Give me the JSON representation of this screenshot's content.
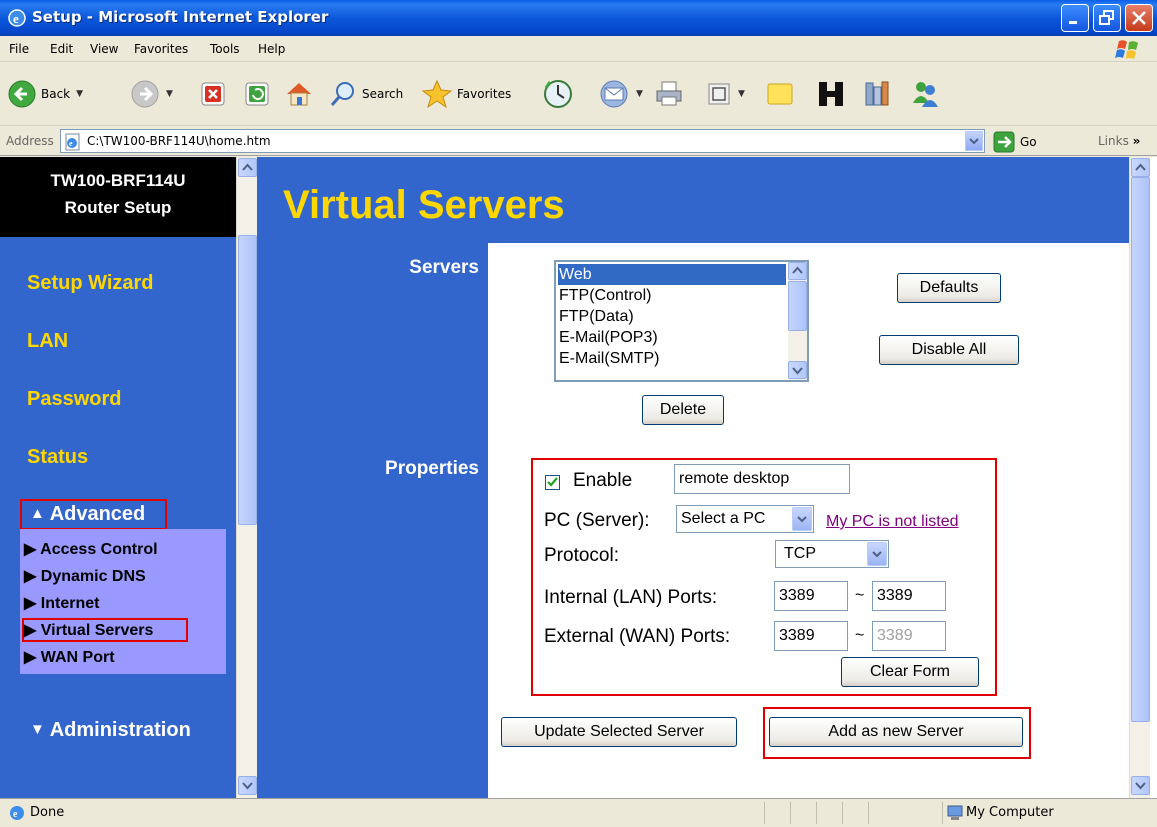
{
  "window": {
    "title": "Setup - Microsoft Internet Explorer"
  },
  "menubar": [
    "File",
    "Edit",
    "View",
    "Favorites",
    "Tools",
    "Help"
  ],
  "toolbar": {
    "back_label": "Back",
    "search_label": "Search",
    "favorites_label": "Favorites"
  },
  "address": {
    "label": "Address",
    "url": "C:\\TW100-BRF114U\\home.htm",
    "go_label": "Go",
    "links_label": "Links"
  },
  "sidebar": {
    "brand_line1": "TW100-BRF114U",
    "brand_line2": "Router Setup",
    "items": [
      {
        "label": "Setup Wizard"
      },
      {
        "label": "LAN"
      },
      {
        "label": "Password"
      },
      {
        "label": "Status"
      }
    ],
    "advanced_label": "Advanced",
    "advanced_marker": "▲",
    "submenu": [
      {
        "label": "Access Control"
      },
      {
        "label": "Dynamic DNS"
      },
      {
        "label": "Internet"
      },
      {
        "label": "Virtual Servers"
      },
      {
        "label": "WAN Port"
      }
    ],
    "submenu_marker": "▶",
    "administration_label": "Administration",
    "administration_marker": "▼"
  },
  "main": {
    "page_title": "Virtual Servers",
    "servers_label": "Servers",
    "servers_list": [
      "Web",
      "FTP(Control)",
      "FTP(Data)",
      "E-Mail(POP3)",
      "E-Mail(SMTP)"
    ],
    "selected_server": "Web",
    "defaults_button": "Defaults",
    "disable_all_button": "Disable All",
    "delete_button": "Delete",
    "properties_label": "Properties",
    "enable_label": "Enable",
    "enable_checked": true,
    "server_name_value": "remote desktop",
    "pc_server_label": "PC (Server):",
    "pc_select_value": "Select a PC",
    "pc_not_listed_link": "My PC is not listed",
    "protocol_label": "Protocol:",
    "protocol_value": "TCP",
    "internal_ports_label": "Internal (LAN) Ports:",
    "internal_port_from": "3389",
    "internal_port_to": "3389",
    "external_ports_label": "External (WAN) Ports:",
    "external_port_from": "3389",
    "external_port_to": "3389",
    "range_separator": "~",
    "clear_form_button": "Clear Form",
    "update_button": "Update Selected Server",
    "add_button": "Add as new Server"
  },
  "statusbar": {
    "status": "Done",
    "zone": "My Computer"
  },
  "colors": {
    "frame_blue": "#3366CC",
    "nav_yellow": "#FFD700",
    "submenu_bg": "#9999FF",
    "highlight_red": "#E00000",
    "selection_blue": "#316AC5"
  }
}
